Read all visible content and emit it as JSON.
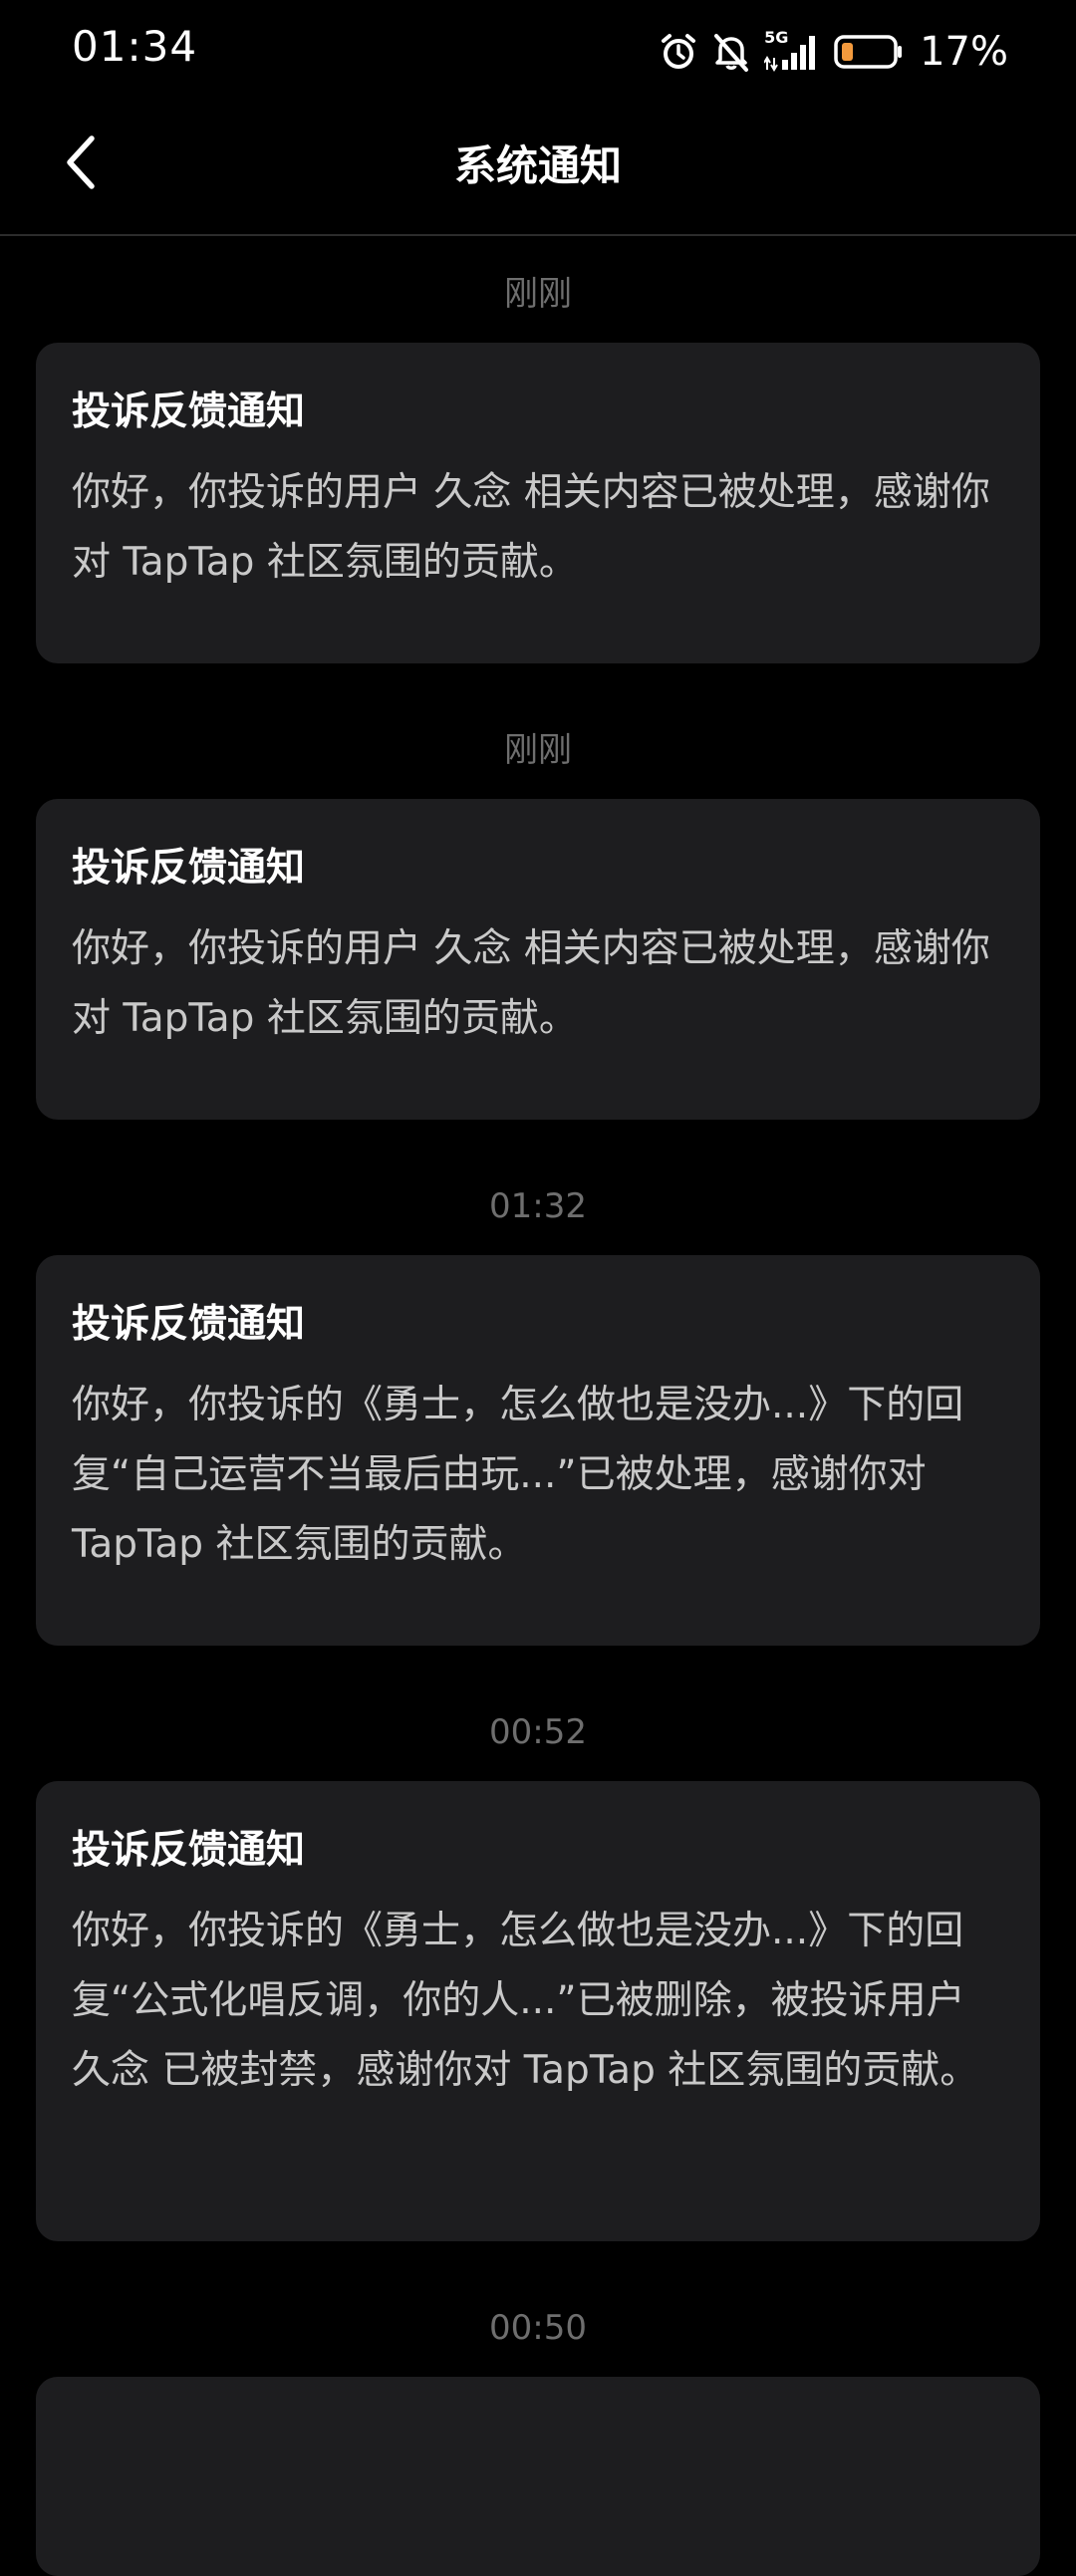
{
  "status_bar": {
    "time": "01:34",
    "network": "5G",
    "battery": "17%",
    "icons": [
      "alarm-icon",
      "mute-bell-icon",
      "signal-5g-icon",
      "battery-icon"
    ]
  },
  "header": {
    "back_icon": "chevron-left-icon",
    "title": "系统通知"
  },
  "notifications": [
    {
      "time": "刚刚",
      "title": "投诉反馈通知",
      "body": "你好，你投诉的用户 久念 相关内容已被处理，感谢你对 TapTap 社区氛围的贡献。"
    },
    {
      "time": "刚刚",
      "title": "投诉反馈通知",
      "body": "你好，你投诉的用户 久念 相关内容已被处理，感谢你对 TapTap 社区氛围的贡献。"
    },
    {
      "time": "01:32",
      "title": "投诉反馈通知",
      "body": "你好，你投诉的《勇士，怎么做也是没办...》下的回复“自己运营不当最后由玩...”已被处理，感谢你对 TapTap 社区氛围的贡献。"
    },
    {
      "time": "00:52",
      "title": "投诉反馈通知",
      "body": "你好，你投诉的《勇士，怎么做也是没办...》下的回复“公式化唱反调，你的人...”已被删除，被投诉用户 久念 已被封禁，感谢你对 TapTap 社区氛围的贡献。"
    },
    {
      "time": "00:50"
    }
  ],
  "colors": {
    "background": "#000000",
    "card": "#1d1d1f",
    "time_label": "#6e6e6e",
    "body_text": "#c9c9c9",
    "battery_fill": "#f39a3d"
  }
}
